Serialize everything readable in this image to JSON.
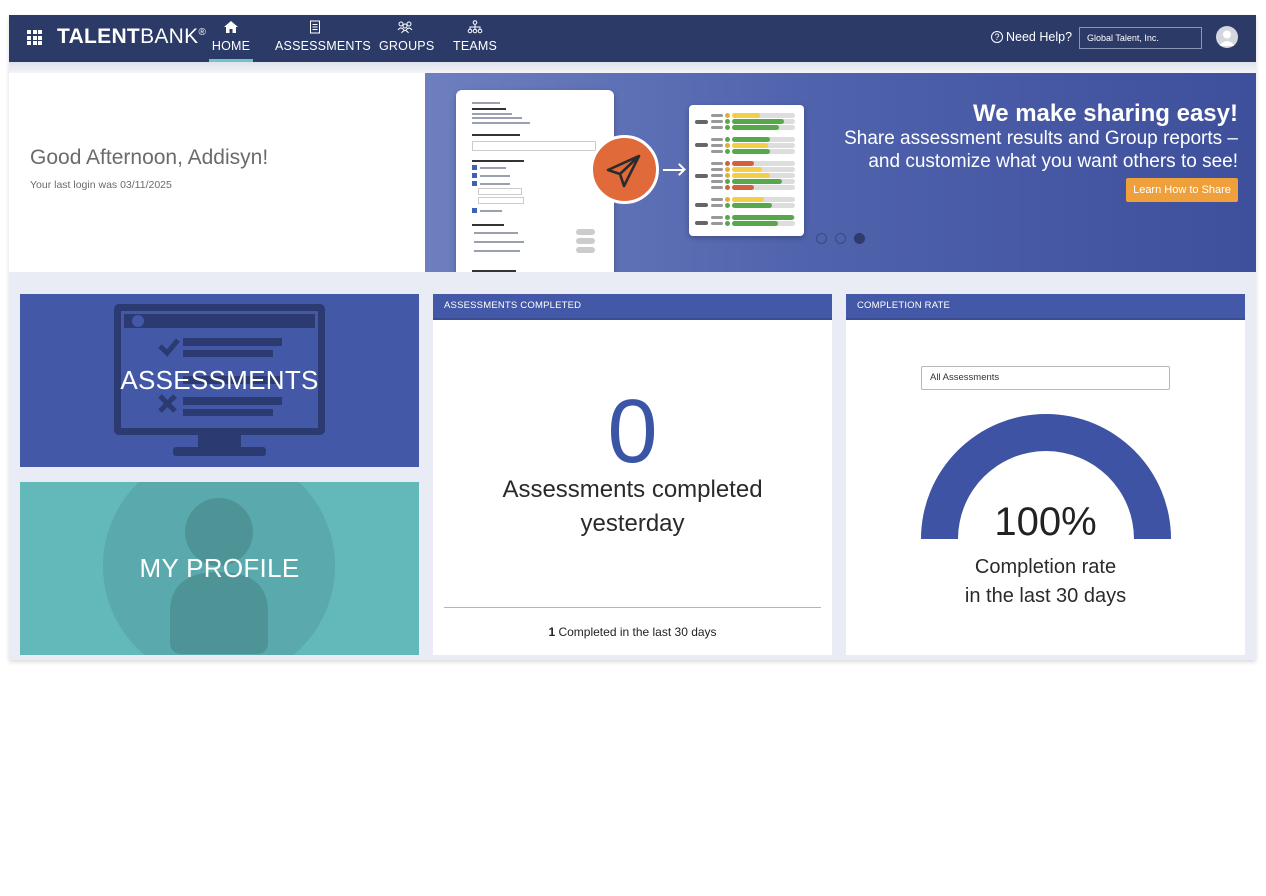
{
  "nav": {
    "logo_bold": "TALENT",
    "logo_light": "BANK",
    "logo_mark": "®",
    "items": [
      {
        "label": "HOME",
        "icon": "home-icon"
      },
      {
        "label": "ASSESSMENTS",
        "icon": "clipboard-icon"
      },
      {
        "label": "GROUPS",
        "icon": "groups-icon"
      },
      {
        "label": "TEAMS",
        "icon": "hierarchy-icon"
      }
    ],
    "help_label": "Need Help?",
    "org_selected": "Global Talent, Inc."
  },
  "greeting": {
    "title": "Good Afternoon, Addisyn!",
    "last_login": "Your last login was 03/11/2025"
  },
  "banner": {
    "heading": "We make sharing easy!",
    "body": "Share assessment results and Group reports – and customize what you want others to see!",
    "button": "Learn How to Share",
    "active_slide": 3,
    "slides": 3
  },
  "tiles": {
    "assessments": "ASSESSMENTS",
    "profile": "MY PROFILE"
  },
  "assessments_card": {
    "header": "ASSESSMENTS COMPLETED",
    "value": "0",
    "caption_line1": "Assessments completed",
    "caption_line2": "yesterday",
    "footer_count": "1",
    "footer_text": " Completed in the last 30 days"
  },
  "completion_card": {
    "header": "COMPLETION RATE",
    "filter_selected": "All Assessments",
    "value": "100%",
    "rate": 1.0,
    "caption_line1": "Completion rate",
    "caption_line2": "in the last 30 days"
  },
  "colors": {
    "nav": "#2c3a68",
    "accent_blue": "#4358a6",
    "teal": "#63b8ba",
    "orange": "#efa03b"
  }
}
